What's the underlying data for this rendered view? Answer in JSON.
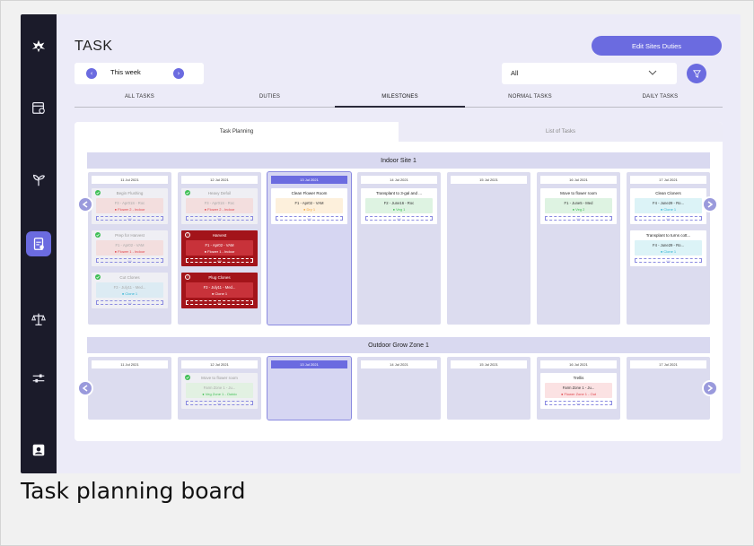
{
  "page": {
    "title": "TASK",
    "edit_button": "Edit Sites Duties",
    "caption": "Task planning board"
  },
  "week_selector": {
    "label": "This week",
    "prev": "‹",
    "next": "›"
  },
  "filter": {
    "selected": "All"
  },
  "tabs": [
    "ALL TASKS",
    "DUTIES",
    "MILESTONES",
    "NORMAL TASKS",
    "DAILY TASKS"
  ],
  "active_tab": "MILESTONES",
  "subtabs": {
    "planning": "Task Planning",
    "list": "List of Tasks"
  },
  "colors": {
    "accent": "#6b6be0",
    "alert": "#a3141a",
    "sidebar": "#1b1b2a"
  },
  "sites": [
    {
      "name": "Indoor Site 1",
      "days": [
        {
          "date": "11 Jul 2021",
          "tasks": [
            {
              "title": "Begin Flushing",
              "line1": "F3 - Apr01S - Roc",
              "line2": "Flower 2 - Indoor",
              "dot": "#e0434a",
              "chip": "#f3dede",
              "state": "done"
            },
            {
              "title": "Prep for Harvest",
              "line1": "F1 - Apr02 - VAM",
              "line2": "Flower 1 - Indoor",
              "dot": "#e0434a",
              "chip": "#f3dede",
              "state": "done"
            },
            {
              "title": "Cut Clones",
              "line1": "F3 - July11 - Med...",
              "line2": "Clone 1",
              "dot": "#2fb3d4",
              "chip": "#dcebf3",
              "state": "done"
            }
          ]
        },
        {
          "date": "12 Jul 2021",
          "tasks": [
            {
              "title": "Heavy Defoil",
              "line1": "F3 - Apr01S - Roc",
              "line2": "Flower 2 - Indoor",
              "dot": "#e0434a",
              "chip": "#f3dede",
              "state": "done"
            },
            {
              "title": "Harvest",
              "line1": "F1 - Apr02 - VAM",
              "line2": "Flower 1 - Indoor",
              "dot": "#ffffff",
              "chip": "#c8323a",
              "state": "alert"
            },
            {
              "title": "Plug Clones",
              "line1": "F3 - July11 - Med...",
              "line2": "Clone 1",
              "dot": "#ffffff",
              "chip": "#c8323a",
              "state": "alert"
            }
          ]
        },
        {
          "date": "13 Jul 2021",
          "tasks": [
            {
              "title": "Clean Flower Room",
              "line1": "F1 - Apr02 - VAM",
              "line2": "Dry 1",
              "dot": "#f2a436",
              "chip": "#fdf0dc",
              "state": "normal"
            }
          ]
        },
        {
          "date": "14 Jul 2021",
          "tasks": [
            {
              "title": "Transplant to 3-gal and ...",
              "line1": "F2 - June16 - Roc",
              "line2": "Veg 1",
              "dot": "#3fbf55",
              "chip": "#def3e2",
              "state": "normal"
            }
          ]
        },
        {
          "date": "15 Jul 2021",
          "tasks": []
        },
        {
          "date": "16 Jul 2021",
          "tasks": [
            {
              "title": "Move to flower room",
              "line1": "F1 - June5 - Med",
              "line2": "Veg 2",
              "dot": "#3fbf55",
              "chip": "#def3e2",
              "state": "normal"
            }
          ]
        },
        {
          "date": "17 Jul 2021",
          "tasks": [
            {
              "title": "Clean Cloners",
              "line1": "F4 - June29 - Ro...",
              "line2": "Clone 1",
              "dot": "#2fb3d4",
              "chip": "#dcf3f7",
              "state": "normal"
            },
            {
              "title": "Transplant to turns cott...",
              "line1": "F4 - June29 - Ro...",
              "line2": "Clone 1",
              "dot": "#2fb3d4",
              "chip": "#dcf3f7",
              "state": "normal"
            }
          ]
        }
      ]
    },
    {
      "name": "Outdoor Grow Zone 1",
      "days": [
        {
          "date": "11 Jul 2021",
          "tasks": []
        },
        {
          "date": "12 Jul 2021",
          "tasks": [
            {
              "title": "Move to flower room",
              "line1": "Farm Zone 1 - Ju...",
              "line2": "Veg Zone 1 - Outdo",
              "dot": "#3fbf55",
              "chip": "#e2f1e2",
              "state": "done"
            }
          ]
        },
        {
          "date": "13 Jul 2021",
          "tasks": []
        },
        {
          "date": "14 Jul 2021",
          "tasks": []
        },
        {
          "date": "15 Jul 2021",
          "tasks": []
        },
        {
          "date": "16 Jul 2021",
          "tasks": [
            {
              "title": "Trellis",
              "line1": "Farm Zone 1 - Ju...",
              "line2": "Flower Zone 1 - Out",
              "dot": "#e0434a",
              "chip": "#fbe2e3",
              "state": "normal"
            }
          ]
        },
        {
          "date": "17 Jul 2021",
          "tasks": []
        }
      ]
    }
  ]
}
